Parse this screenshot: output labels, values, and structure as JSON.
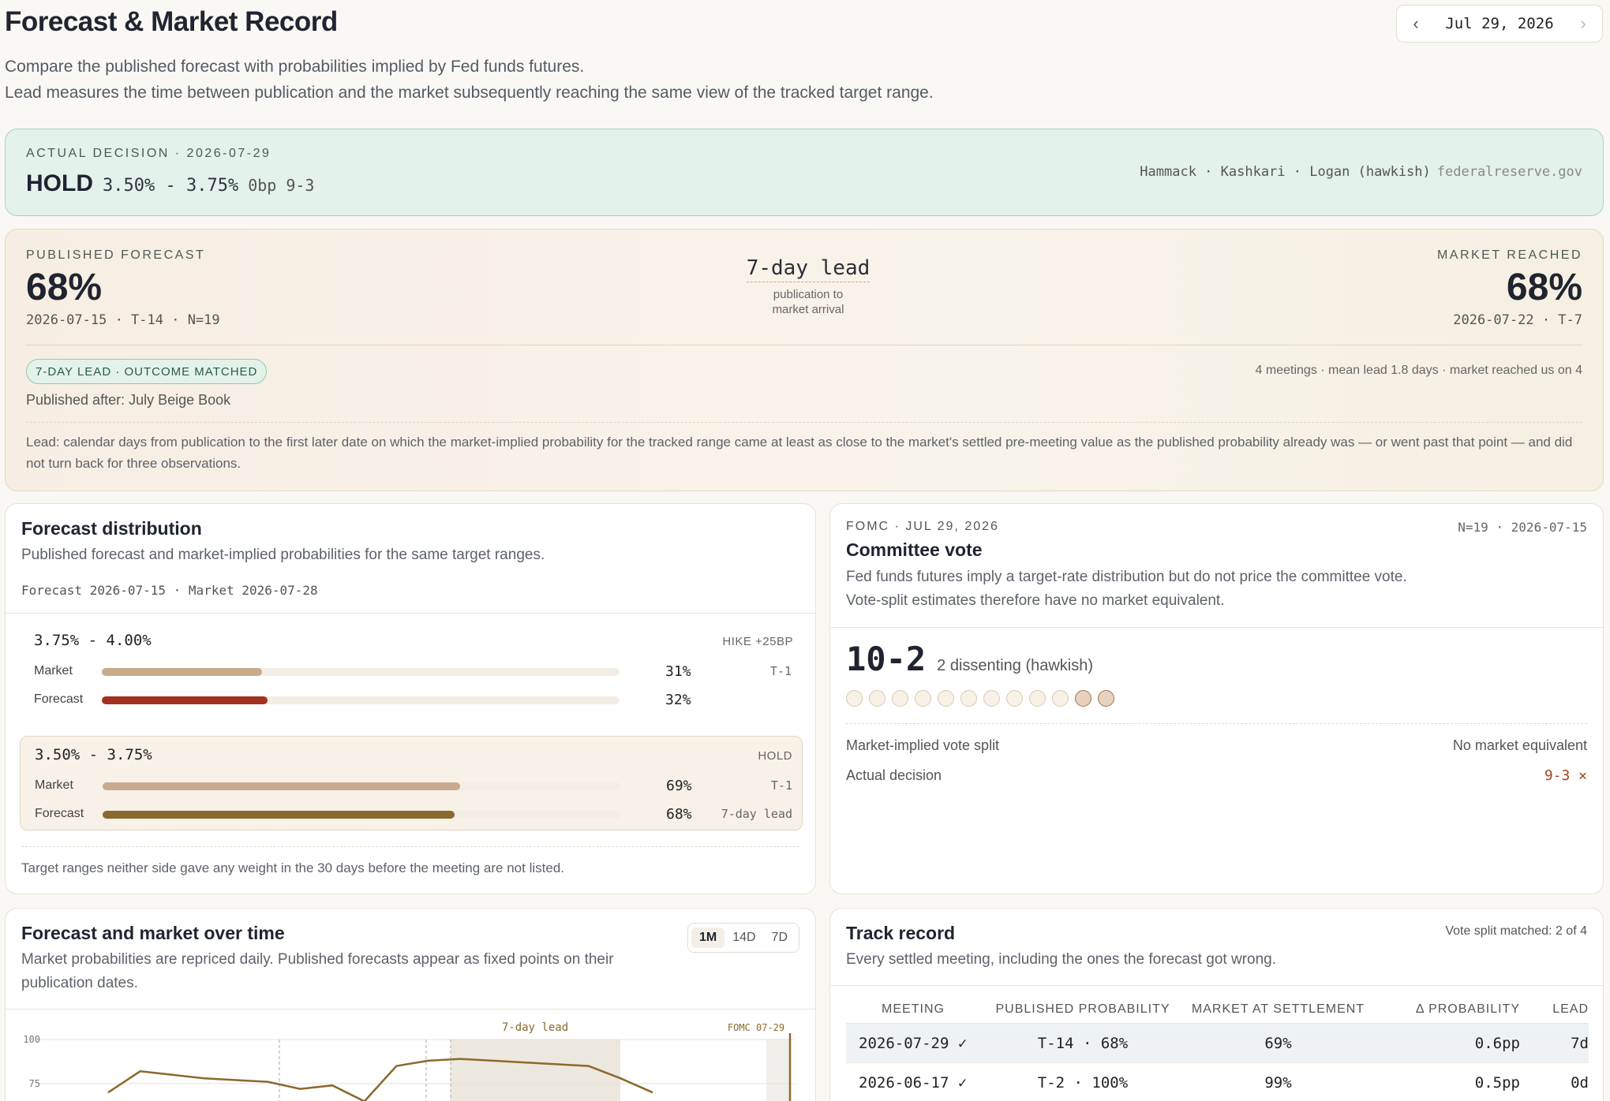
{
  "header": {
    "title": "Forecast & Market Record",
    "date": "Jul 29, 2026",
    "desc_line1": "Compare the published forecast with probabilities implied by Fed funds futures.",
    "desc_line2": "Lead measures the time between publication and the market subsequently reaching the same view of the tracked target range."
  },
  "actual": {
    "label": "ACTUAL DECISION · 2026-07-29",
    "decision": "HOLD",
    "range": "3.50% - 3.75%",
    "bp_split": "0bp 9-3",
    "dissenters": "Hammack · Kashkari · Logan (hawkish)",
    "source": "federalreserve.gov"
  },
  "published": {
    "label": "PUBLISHED FORECAST",
    "value": "68%",
    "meta": "2026-07-15 · T-14 · N=19",
    "lead_value": "7-day lead",
    "lead_sub1": "publication to",
    "lead_sub2": "market arrival",
    "market_label": "MARKET REACHED",
    "market_value": "68%",
    "market_meta": "2026-07-22 · T-7",
    "badge": "7-DAY LEAD · OUTCOME MATCHED",
    "stats": "4 meetings · mean lead 1.8 days · market reached us on 4",
    "after": "Published after: July Beige Book",
    "note": "Lead: calendar days from publication to the first later date on which the market-implied probability for the tracked range came at least as close to the market's settled pre-meeting value as the published probability already was — or went past that point — and did not turn back for three observations."
  },
  "distribution": {
    "title": "Forecast distribution",
    "desc": "Published forecast and market-implied probabilities for the same target ranges.",
    "sub": "Forecast 2026-07-15 · Market 2026-07-28",
    "market_label": "Market",
    "forecast_label": "Forecast",
    "ranges": [
      {
        "name": "3.75% - 4.00%",
        "tag": "HIKE +25BP",
        "market": 31,
        "market_pct": "31%",
        "market_aux": "T-1",
        "forecast": 32,
        "forecast_pct": "32%",
        "forecast_aux": ""
      },
      {
        "name": "3.50% - 3.75%",
        "tag": "HOLD",
        "market": 69,
        "market_pct": "69%",
        "market_aux": "T-1",
        "forecast": 68,
        "forecast_pct": "68%",
        "forecast_aux": "7-day lead"
      }
    ],
    "colors": {
      "market": "#c7ab8c",
      "forecast_hike": "#a3301f",
      "forecast_hold": "#8a6a2c"
    },
    "footnote": "Target ranges neither side gave any weight in the 30 days before the meeting are not listed."
  },
  "committee": {
    "kicker": "FOMC · JUL 29, 2026",
    "kicker_right": "N=19 · 2026-07-15",
    "title": "Committee vote",
    "desc": "Fed funds futures imply a target-rate distribution but do not price the committee vote. Vote-split estimates therefore have no market equivalent.",
    "vote": "10-2",
    "vote_desc": "2 dissenting (hawkish)",
    "votes_total": 12,
    "votes_dissent": 2,
    "row1_label": "Market-implied vote split",
    "row1_value": "No market equivalent",
    "row2_label": "Actual decision",
    "row2_value": "9-3 ✕"
  },
  "overtime": {
    "title": "Forecast and market over time",
    "desc": "Market probabilities are repriced daily. Published forecasts appear as fixed points on their publication dates.",
    "ranges": [
      "1M",
      "14D",
      "7D"
    ],
    "lead_annotation": "7-day lead",
    "fomc_annotation": "FOMC 07-29",
    "y_ticks": [
      "100",
      "75"
    ]
  },
  "chart_data": {
    "type": "line",
    "title": "Forecast and market over time",
    "series": [
      {
        "values": [
          70,
          82,
          80,
          78,
          77,
          76,
          72,
          74,
          65,
          85,
          88,
          89,
          88,
          87,
          86,
          85,
          78,
          70
        ]
      }
    ],
    "ylim": [
      0,
      100
    ],
    "annotations": [
      "7-day lead",
      "FOMC 07-29"
    ]
  },
  "track": {
    "title": "Track record",
    "desc": "Every settled meeting, including the ones the forecast got wrong.",
    "summary": "Vote split matched: 2 of 4",
    "headers": [
      "MEETING",
      "PUBLISHED PROBABILITY",
      "MARKET AT SETTLEMENT",
      "Δ PROBABILITY",
      "LEAD"
    ],
    "rows": [
      [
        "2026-07-29 ✓",
        "T-14 · 68%",
        "69%",
        "0.6pp",
        "7d"
      ],
      [
        "2026-06-17 ✓",
        "T-2 · 100%",
        "99%",
        "0.5pp",
        "0d"
      ]
    ]
  }
}
